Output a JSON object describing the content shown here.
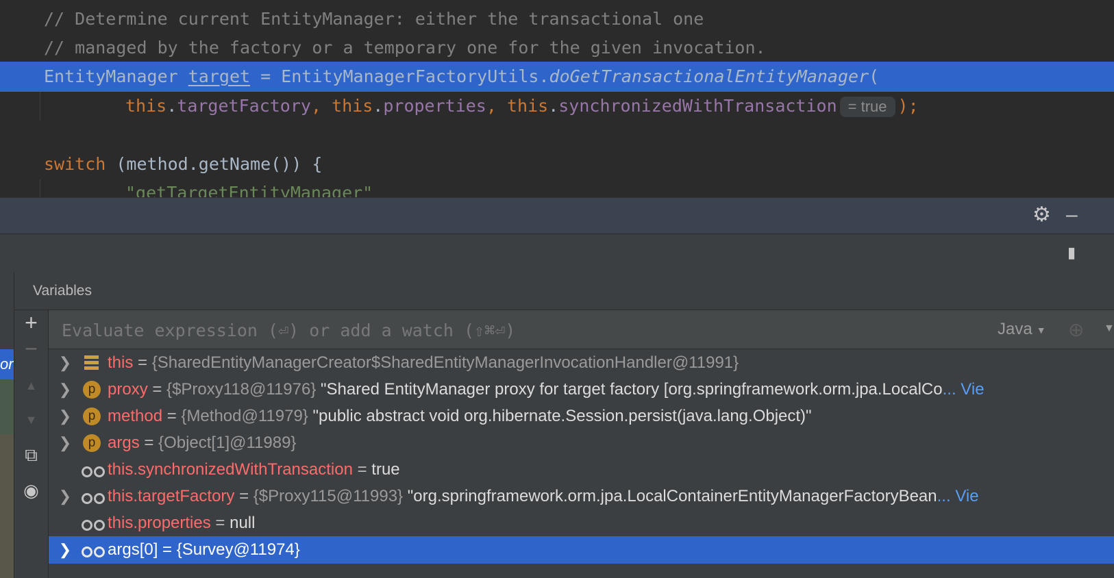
{
  "editor": {
    "line1": "// Determine current EntityManager: either the transactional one",
    "line2": "// managed by the factory or a temporary one for the given invocation.",
    "line3": {
      "type": "EntityManager",
      "var": "target",
      "eq": " = ",
      "cls": "EntityManagerFactoryUtils.",
      "method": "doGetTransactionalEntityManager",
      "paren": "("
    },
    "line4": {
      "this1": "this",
      "dot1": ".",
      "f1": "targetFactory",
      "sep1": ", ",
      "this2": "this",
      "dot2": ".",
      "f2": "properties",
      "sep2": ", ",
      "this3": "this",
      "dot3": ".",
      "f3": "synchronizedWithTransaction",
      "hint": "= true",
      "end": ");"
    },
    "line5": {
      "kw": "switch",
      "rest": " (method.getName()) {"
    },
    "line6": "\"getTargetEntityManager\""
  },
  "variables_panel": {
    "title": "Variables",
    "frame_label": "or",
    "eval_placeholder": "Evaluate expression (⏎) or add a watch (⇧⌘⏎)",
    "language": "Java"
  },
  "tree": [
    {
      "icon": "this",
      "expandable": true,
      "name": "this",
      "eq": " = ",
      "type": "{SharedEntityManagerCreator$SharedEntityManagerInvocationHandler@11991}",
      "value": "",
      "view": ""
    },
    {
      "icon": "param",
      "expandable": true,
      "name": "proxy",
      "eq": " = ",
      "type": "{$Proxy118@11976}",
      "value": " \"Shared EntityManager proxy for target factory [org.springframework.orm.jpa.LocalCo",
      "view": "Vie"
    },
    {
      "icon": "param",
      "expandable": true,
      "name": "method",
      "eq": " = ",
      "type": "{Method@11979}",
      "value": " \"public abstract void org.hibernate.Session.persist(java.lang.Object)\"",
      "view": ""
    },
    {
      "icon": "param",
      "expandable": true,
      "name": "args",
      "eq": " = ",
      "type": "{Object[1]@11989}",
      "value": "",
      "view": ""
    },
    {
      "icon": "watch",
      "expandable": false,
      "name": "this.synchronizedWithTransaction",
      "eq": " = ",
      "type": "",
      "value": "true",
      "view": ""
    },
    {
      "icon": "watch",
      "expandable": true,
      "name": "this.targetFactory",
      "eq": " = ",
      "type": "{$Proxy115@11993}",
      "value": " \"org.springframework.orm.jpa.LocalContainerEntityManagerFactoryBean",
      "view": "Vie"
    },
    {
      "icon": "watch",
      "expandable": false,
      "name": "this.properties",
      "eq": " = ",
      "type": "",
      "value": "null",
      "view": ""
    },
    {
      "icon": "watch",
      "expandable": true,
      "name": "args[0]",
      "eq": " = ",
      "type": "",
      "value": "{Survey@11974}",
      "view": "",
      "selected": true
    }
  ],
  "colors": {
    "selection": "#2f65ca",
    "var_name": "#ff6b6b",
    "keyword": "#cc7832",
    "field": "#9876aa",
    "method": "#ffc66d"
  }
}
